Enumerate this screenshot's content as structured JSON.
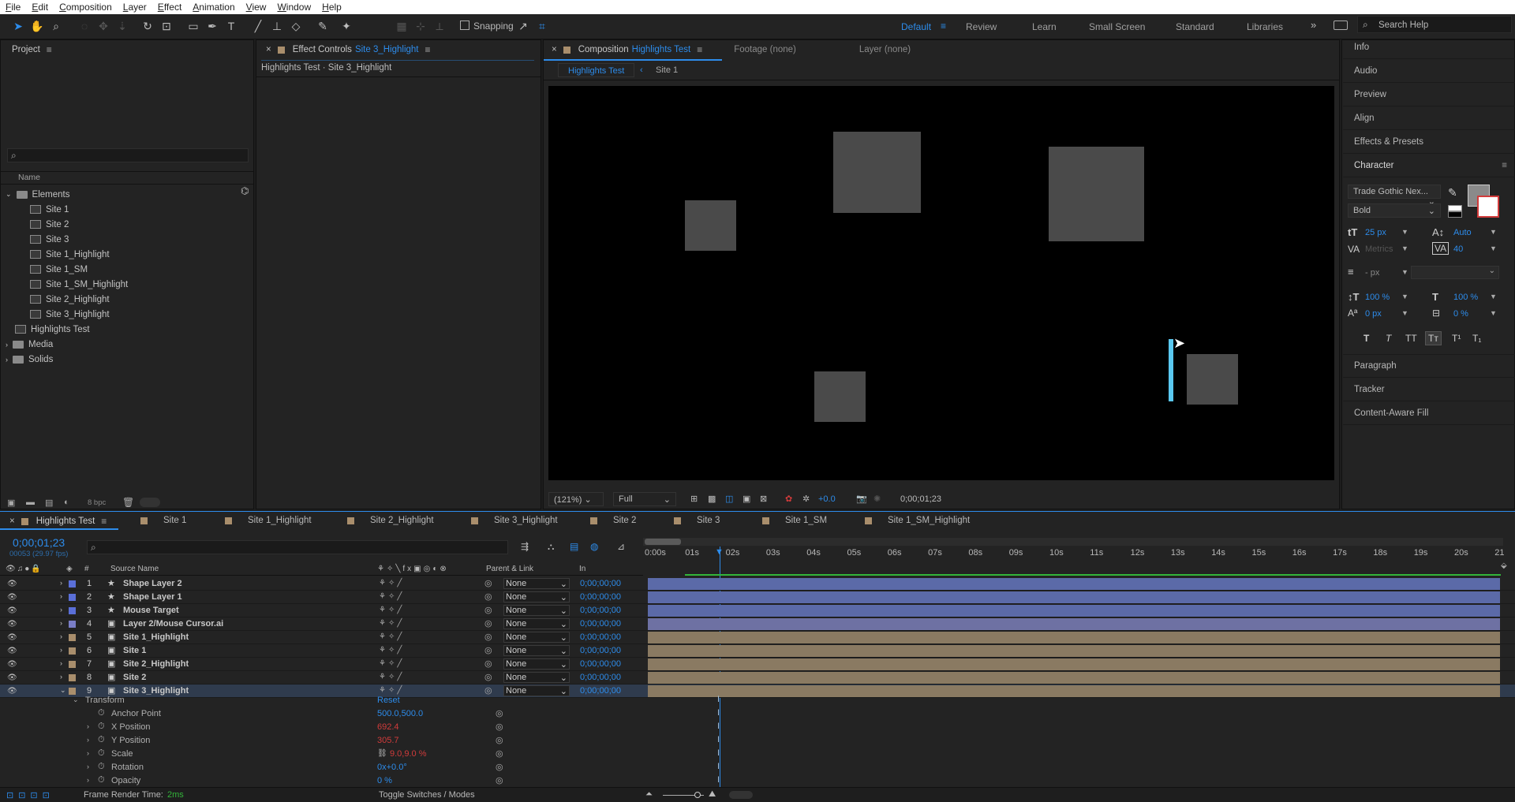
{
  "menu": [
    "File",
    "Edit",
    "Composition",
    "Layer",
    "Effect",
    "Animation",
    "View",
    "Window",
    "Help"
  ],
  "toolbar": {
    "snapping_label": "Snapping"
  },
  "workspaces": [
    "Default",
    "Review",
    "Learn",
    "Small Screen",
    "Standard",
    "Libraries"
  ],
  "search_help": "Search Help",
  "project": {
    "title": "Project",
    "column_name": "Name",
    "bpc": "8 bpc",
    "items": [
      {
        "label": "Elements",
        "type": "folder",
        "level": 0,
        "expanded": true
      },
      {
        "label": "Site 1",
        "type": "comp",
        "level": 1
      },
      {
        "label": "Site 2",
        "type": "comp",
        "level": 1
      },
      {
        "label": "Site 3",
        "type": "comp",
        "level": 1
      },
      {
        "label": "Site 1_Highlight",
        "type": "comp",
        "level": 1
      },
      {
        "label": "Site 1_SM",
        "type": "comp",
        "level": 1
      },
      {
        "label": "Site 1_SM_Highlight",
        "type": "comp",
        "level": 1
      },
      {
        "label": "Site 2_Highlight",
        "type": "comp",
        "level": 1
      },
      {
        "label": "Site 3_Highlight",
        "type": "comp",
        "level": 1
      },
      {
        "label": "Highlights Test",
        "type": "comp",
        "level": 0
      },
      {
        "label": "Media",
        "type": "folder",
        "level": 0
      },
      {
        "label": "Solids",
        "type": "folder",
        "level": 0
      }
    ]
  },
  "effect_controls": {
    "title": "Effect Controls",
    "layer": "Site 3_Highlight",
    "breadcrumb": "Highlights Test · Site 3_Highlight"
  },
  "composition": {
    "title": "Composition",
    "comp_name": "Highlights Test",
    "footage_tab": "Footage (none)",
    "layer_tab": "Layer (none)",
    "nav_current": "Highlights Test",
    "nav_next": "Site 1",
    "zoom": "(121%)",
    "resolution": "Full",
    "exposure": "+0.0",
    "timecode": "0;00;01;23"
  },
  "right_panels": [
    "Info",
    "Audio",
    "Preview",
    "Align",
    "Effects & Presets"
  ],
  "character": {
    "title": "Character",
    "font": "Trade Gothic Nex...",
    "style": "Bold",
    "size": "25 px",
    "leading": "Auto",
    "kerning": "Metrics",
    "tracking": "40",
    "stroke": "- px",
    "vscale": "100 %",
    "hscale": "100 %",
    "baseline": "0 px",
    "tsume": "0 %",
    "style_buttons": [
      "T",
      "T",
      "TT",
      "Tт",
      "T¹",
      "T₁"
    ]
  },
  "right_panels_lower": [
    "Paragraph",
    "Tracker",
    "Content-Aware Fill"
  ],
  "timeline_tabs": [
    "Highlights Test",
    "Site 1",
    "Site 1_Highlight",
    "Site 2_Highlight",
    "Site 3_Highlight",
    "Site 2",
    "Site 3",
    "Site 1_SM",
    "Site 1_SM_Highlight"
  ],
  "timeline": {
    "timecode": "0;00;01;23",
    "frames": "00053 (29.97 fps)",
    "col_source": "Source Name",
    "col_parent": "Parent & Link",
    "col_in": "In",
    "ruler": [
      "0:00s",
      "01s",
      "02s",
      "03s",
      "04s",
      "05s",
      "06s",
      "07s",
      "08s",
      "09s",
      "10s",
      "11s",
      "12s",
      "13s",
      "14s",
      "15s",
      "16s",
      "17s",
      "18s",
      "19s",
      "20s",
      "21"
    ],
    "layers": [
      {
        "num": "1",
        "name": "Shape Layer 2",
        "color": "#5a6fd8",
        "parent": "None",
        "in": "0;00;00;00",
        "bar": "#5b6aa8"
      },
      {
        "num": "2",
        "name": "Shape Layer 1",
        "color": "#5a6fd8",
        "parent": "None",
        "in": "0;00;00;00",
        "bar": "#5b6aa8"
      },
      {
        "num": "3",
        "name": "Mouse Target",
        "color": "#5a6fd8",
        "parent": "None",
        "in": "0;00;00;00",
        "bar": "#5b6aa8"
      },
      {
        "num": "4",
        "name": "Layer 2/Mouse Cursor.ai",
        "color": "#7a7ec7",
        "parent": "None",
        "in": "0;00;00;00",
        "bar": "#6e71a3"
      },
      {
        "num": "5",
        "name": "Site 1_Highlight",
        "color": "#a98e6c",
        "parent": "None",
        "in": "0;00;00;00",
        "bar": "#8a7a62"
      },
      {
        "num": "6",
        "name": "Site 1",
        "color": "#a98e6c",
        "parent": "None",
        "in": "0;00;00;00",
        "bar": "#8a7a62"
      },
      {
        "num": "7",
        "name": "Site 2_Highlight",
        "color": "#a98e6c",
        "parent": "None",
        "in": "0;00;00;00",
        "bar": "#8a7a62"
      },
      {
        "num": "8",
        "name": "Site 2",
        "color": "#a98e6c",
        "parent": "None",
        "in": "0;00;00;00",
        "bar": "#8a7a62"
      },
      {
        "num": "9",
        "name": "Site 3_Highlight",
        "color": "#a98e6c",
        "parent": "None",
        "in": "0;00;00;00",
        "bar": "#8a7a62"
      }
    ],
    "transform_label": "Transform",
    "reset_label": "Reset",
    "properties": [
      {
        "name": "Anchor Point",
        "value": "500.0,500.0",
        "color": "#2d8ceb"
      },
      {
        "name": "X Position",
        "value": "692.4",
        "color": "#d13b3b"
      },
      {
        "name": "Y Position",
        "value": "305.7",
        "color": "#d13b3b"
      },
      {
        "name": "Scale",
        "value": "9.0,9.0 %",
        "color": "#d13b3b"
      },
      {
        "name": "Rotation",
        "value": "0x+0.0°",
        "color": "#2d8ceb"
      },
      {
        "name": "Opacity",
        "value": "0 %",
        "color": "#2d8ceb"
      }
    ],
    "render_time_label": "Frame Render Time:",
    "render_time": "2ms",
    "toggle_label": "Toggle Switches / Modes"
  },
  "colors": {
    "accent": "#2d8ceb",
    "keyframe": "#d13b3b",
    "workarea": "#33b53a"
  }
}
